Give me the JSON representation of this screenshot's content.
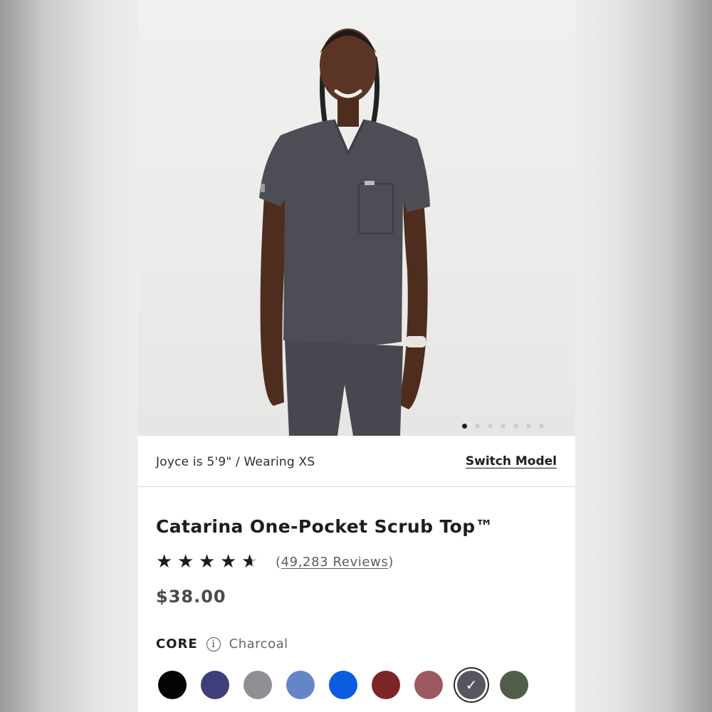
{
  "gallery": {
    "dot_count": 7,
    "active_index": 0
  },
  "model": {
    "info": "Joyce is 5'9\" / Wearing XS",
    "switch_label": "Switch Model"
  },
  "product": {
    "title": "Catarina One-Pocket Scrub Top™",
    "rating": 4.5,
    "reviews_open": "(",
    "reviews_label": "49,283 Reviews",
    "reviews_close": ")",
    "price": "$38.00"
  },
  "colors": {
    "collection": "CORE",
    "info_icon_glyph": "i",
    "selected_name": "Charcoal",
    "swatches": [
      "#050505",
      "#3d3e7a",
      "#8e9096",
      "#6585c9",
      "#0a5ce0",
      "#7d2526",
      "#9d5860",
      "#575560",
      "#515c49"
    ],
    "selected_index": 7
  }
}
